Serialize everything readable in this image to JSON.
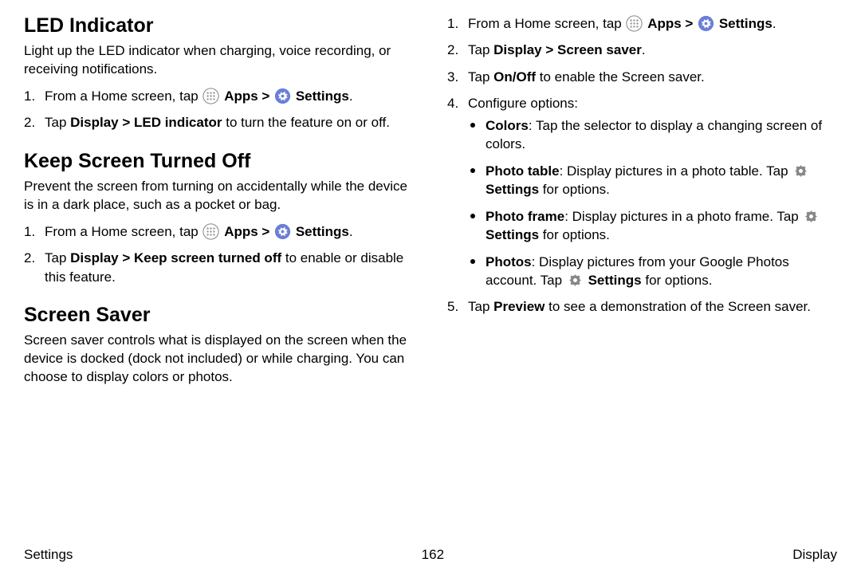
{
  "sections": {
    "led": {
      "title": "LED Indicator",
      "intro": "Light up the LED indicator when charging, voice recording, or receiving notifications.",
      "step1_prefix": "From a Home screen, tap ",
      "apps_label": "Apps",
      "settings_label": "Settings",
      "step2_a": "Tap ",
      "step2_b": "Display > LED indicator",
      "step2_c": " to turn the feature on or off."
    },
    "keep": {
      "title": "Keep Screen Turned Off",
      "intro": "Prevent the screen from turning on accidentally while the device is in a dark place, such as a pocket or bag.",
      "step1_prefix": "From a Home screen, tap ",
      "apps_label": "Apps",
      "settings_label": "Settings",
      "step2_a": "Tap ",
      "step2_b": "Display > Keep screen turned off",
      "step2_c": " to enable or disable this feature."
    },
    "saver": {
      "title": "Screen Saver",
      "intro": "Screen saver controls what is displayed on the screen when the device is docked (dock not included) or while charging. You can choose to display colors or photos.",
      "step1_prefix": "From a Home screen, tap ",
      "apps_label": "Apps",
      "settings_label": "Settings",
      "step2_a": "Tap ",
      "step2_b": "Display > Screen saver",
      "step3_a": "Tap ",
      "step3_b": "On/Off",
      "step3_c": " to enable the Screen saver.",
      "step4": "Configure options:",
      "opt_colors_b": "Colors",
      "opt_colors_t": ": Tap the selector to display a changing screen of colors.",
      "opt_table_b": "Photo table",
      "opt_table_t1": ": Display pictures in a photo table. Tap ",
      "opt_table_set": "Settings",
      "opt_table_t2": " for options.",
      "opt_frame_b": "Photo frame",
      "opt_frame_t1": ": Display pictures in a photo frame. Tap ",
      "opt_frame_set": "Settings",
      "opt_frame_t2": " for options.",
      "opt_photos_b": "Photos",
      "opt_photos_t1": ": Display pictures from your Google Photos account. Tap ",
      "opt_photos_set": "Settings",
      "opt_photos_t2": " for options.",
      "step5_a": "Tap ",
      "step5_b": "Preview",
      "step5_c": " to see a demonstration of the Screen saver."
    }
  },
  "common": {
    "chevron": " > ",
    "period": "."
  },
  "footer": {
    "left": "Settings",
    "center": "162",
    "right": "Display"
  }
}
